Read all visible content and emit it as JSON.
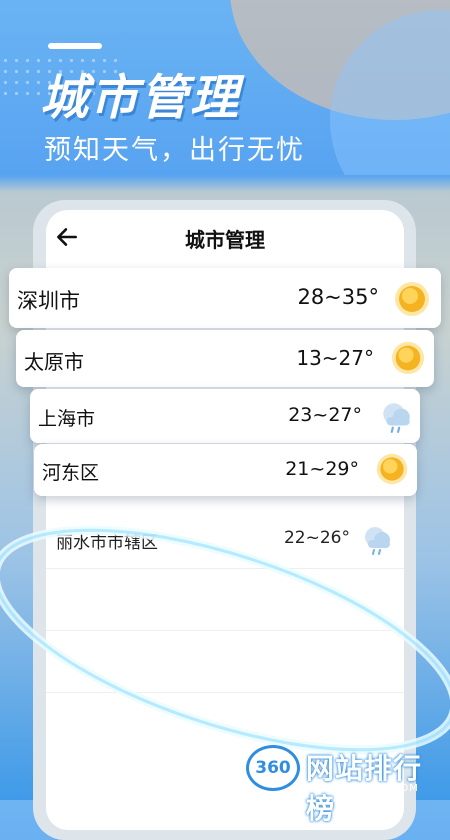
{
  "hero": {
    "title": "城市管理",
    "subtitle": "预知天气，出行无忧"
  },
  "nav": {
    "back_icon": "back-arrow-icon",
    "title": "城市管理"
  },
  "cities": [
    {
      "name": "深圳市",
      "temp": "28~35°",
      "weather_icon": "sunny-icon"
    },
    {
      "name": "太原市",
      "temp": "13~27°",
      "weather_icon": "sunny-icon"
    },
    {
      "name": "上海市",
      "temp": "23~27°",
      "weather_icon": "rain-cloud-icon"
    },
    {
      "name": "河东区",
      "temp": "21~29°",
      "weather_icon": "sunny-icon"
    },
    {
      "name": "丽水市市辖区",
      "temp": "22~26°",
      "weather_icon": "rain-cloud-icon"
    }
  ],
  "watermark": {
    "logo": "360",
    "text": "网站排行榜",
    "url": "WANGZHAN360.COM"
  },
  "colors": {
    "accent": "#5aa5f0",
    "sun": "#f5b321",
    "cloud": "#b9d6ee"
  }
}
